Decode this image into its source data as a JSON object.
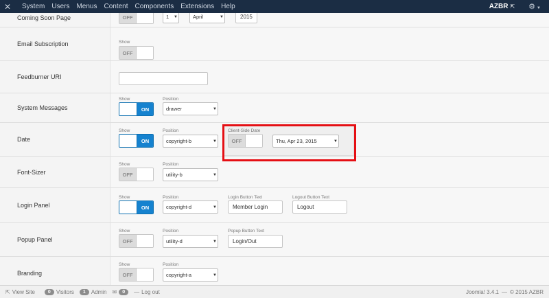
{
  "topbar": {
    "logo_icon": "joomla-logo-icon",
    "menu": [
      "System",
      "Users",
      "Menus",
      "Content",
      "Components",
      "Extensions",
      "Help"
    ],
    "site_name": "AZBR",
    "site_link_icon": "external-link-icon",
    "settings_icon": "gear-icon"
  },
  "rows": {
    "coming_soon": {
      "label": "Coming Soon Page",
      "toggle": "OFF",
      "day": "1",
      "month": "April",
      "year": "2015"
    },
    "email_subscription": {
      "label": "Email Subscription",
      "show_label": "Show",
      "toggle": "OFF"
    },
    "feedburner": {
      "label": "Feedburner URI",
      "value": ""
    },
    "system_messages": {
      "label": "System Messages",
      "show_label": "Show",
      "toggle": "ON",
      "position_label": "Position",
      "position": "drawer"
    },
    "date": {
      "label": "Date",
      "show_label": "Show",
      "toggle": "ON",
      "position_label": "Position",
      "position": "copyright-b",
      "client_side_label": "Client-Side Date",
      "client_side_toggle": "OFF",
      "format": "Thu, Apr 23, 2015",
      "highlight_color": "#e50f14"
    },
    "font_sizer": {
      "label": "Font-Sizer",
      "show_label": "Show",
      "toggle": "OFF",
      "position_label": "Position",
      "position": "utility-b"
    },
    "login_panel": {
      "label": "Login Panel",
      "show_label": "Show",
      "toggle": "ON",
      "position_label": "Position",
      "position": "copyright-d",
      "login_text_label": "Login Button Text",
      "login_text": "Member Login",
      "logout_text_label": "Logout Button Text",
      "logout_text": "Logout"
    },
    "popup_panel": {
      "label": "Popup Panel",
      "show_label": "Show",
      "toggle": "OFF",
      "position_label": "Position",
      "position": "utility-d",
      "popup_text_label": "Popup Button Text",
      "popup_text": "Login/Out"
    },
    "branding": {
      "label": "Branding",
      "show_label": "Show",
      "toggle": "OFF",
      "position_label": "Position",
      "position": "copyright-a"
    }
  },
  "footer": {
    "view_site": "View Site",
    "visitors_count": "0",
    "visitors_label": "Visitors",
    "admin_count": "1",
    "admin_label": "Admin",
    "messages_count": "0",
    "logout": "Log out",
    "version": "Joomla! 3.4.1",
    "separator": "—",
    "copyright": "© 2015 AZBR"
  },
  "colors": {
    "topbar_bg": "#1b2d44",
    "toggle_on": "#1582cf",
    "highlight": "#e50f14"
  }
}
